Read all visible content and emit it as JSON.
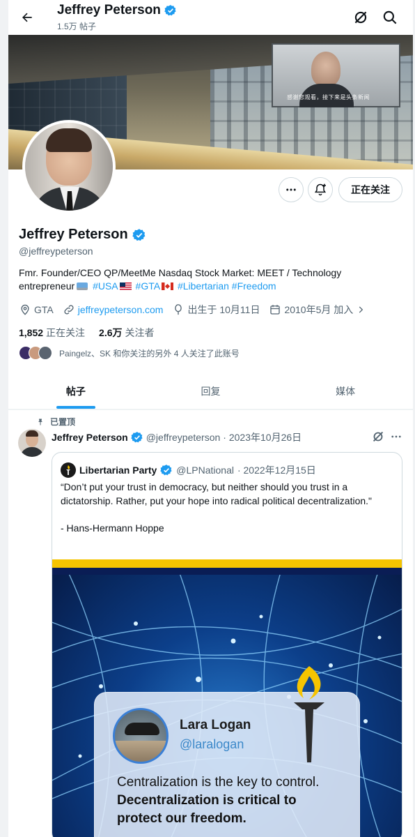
{
  "header": {
    "name": "Jeffrey Peterson",
    "post_count": "1.5万 帖子"
  },
  "profile": {
    "name": "Jeffrey Peterson",
    "handle": "@jeffreypeterson",
    "bio_text": "Fmr. Founder/CEO QP/MeetMe Nasdaq Stock Market: MEET / Technology entrepreneur",
    "bio_tags": [
      "#USA",
      "#GTA",
      "#Libertarian",
      "#Freedom"
    ],
    "location": "GTA",
    "website": "jeffreypeterson.com",
    "birthday": "出生于 10月11日",
    "joined": "2010年5月 加入",
    "following_count": "1,852",
    "following_label": "正在关注",
    "followers_count": "2.6万",
    "followers_label": "关注者",
    "followed_by": "Paingelz、SK 和你关注的另外 4 人关注了此账号",
    "follow_button": "正在关注",
    "banner_caption": "感谢您观看，接下来是头条新闻"
  },
  "tabs": [
    {
      "label": "帖子",
      "active": true
    },
    {
      "label": "回复",
      "active": false
    },
    {
      "label": "媒体",
      "active": false
    }
  ],
  "post": {
    "pinned_label": "已置顶",
    "author_name": "Jeffrey Peterson",
    "author_handle": "@jeffreypeterson",
    "date": "· 2023年10月26日",
    "quote": {
      "author_name": "Libertarian Party",
      "author_handle": "@LPNational",
      "date": "· 2022年12月15日",
      "text": "“Don’t put your trust in democracy, but neither should you trust in a dictatorship. Rather, put your hope into radical political decentralization.\"\n\n- Hans-Hermann Hoppe",
      "image": {
        "card_name": "Lara Logan",
        "card_handle": "@laralogan",
        "line1": "Centralization is the key to control.",
        "line2": "Decentralization is critical to",
        "line3": "protect our freedom."
      }
    }
  },
  "colors": {
    "accent": "#1d9bf0",
    "text": "#0f1419",
    "muted": "#536471",
    "border": "#cfd9de",
    "lp_yellow": "#f5c400"
  },
  "icons": [
    "back-arrow-icon",
    "verified-icon",
    "grok-icon",
    "search-icon",
    "more-icon",
    "bell-plus-icon",
    "location-icon",
    "link-icon",
    "balloon-icon",
    "calendar-icon",
    "pin-icon",
    "lp-torch-icon"
  ]
}
